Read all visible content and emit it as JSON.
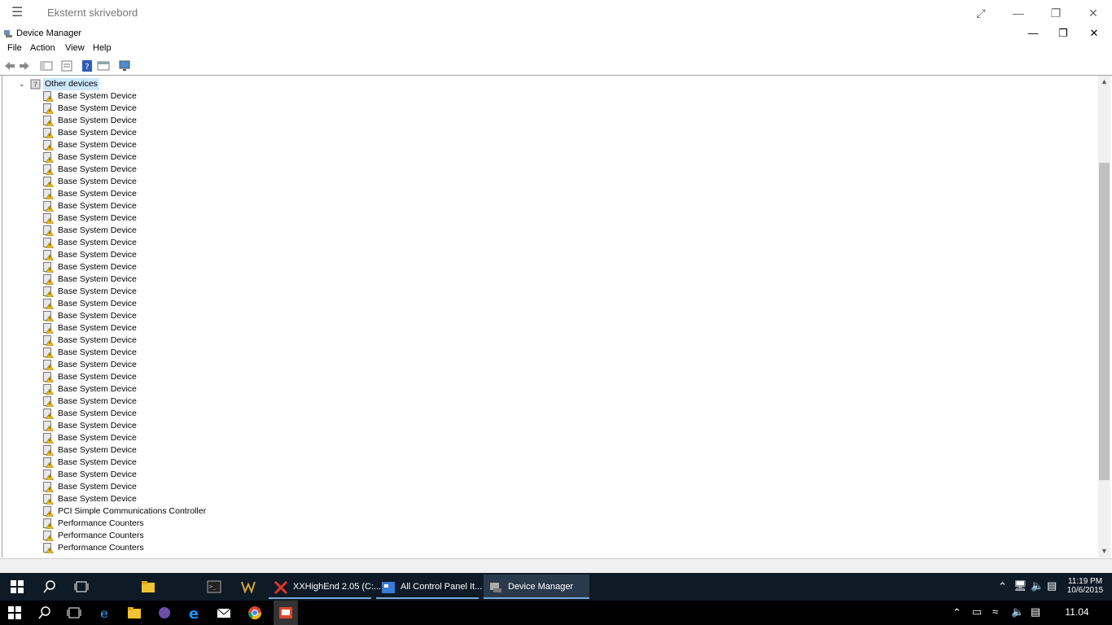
{
  "remote": {
    "title": "Eksternt skrivebord"
  },
  "window": {
    "title": "Device Manager"
  },
  "menu": [
    "File",
    "Action",
    "View",
    "Help"
  ],
  "tree": {
    "category": "Other devices",
    "items": [
      "Base System Device",
      "Base System Device",
      "Base System Device",
      "Base System Device",
      "Base System Device",
      "Base System Device",
      "Base System Device",
      "Base System Device",
      "Base System Device",
      "Base System Device",
      "Base System Device",
      "Base System Device",
      "Base System Device",
      "Base System Device",
      "Base System Device",
      "Base System Device",
      "Base System Device",
      "Base System Device",
      "Base System Device",
      "Base System Device",
      "Base System Device",
      "Base System Device",
      "Base System Device",
      "Base System Device",
      "Base System Device",
      "Base System Device",
      "Base System Device",
      "Base System Device",
      "Base System Device",
      "Base System Device",
      "Base System Device",
      "Base System Device",
      "Base System Device",
      "Base System Device",
      "PCI Simple Communications Controller",
      "Performance Counters",
      "Performance Counters",
      "Performance Counters"
    ]
  },
  "inner_taskbar": {
    "tasks": [
      {
        "label": "XXHighEnd 2.05 (C:..."
      },
      {
        "label": "All Control Panel It..."
      },
      {
        "label": "Device Manager"
      }
    ],
    "clock_time": "11:19 PM",
    "clock_date": "10/6/2015"
  },
  "outer_taskbar": {
    "clock_time": "11.04"
  },
  "colors": {
    "taskbar_inner": "#0e1a26",
    "taskbar_outer": "#000000",
    "selection": "#cce8ff",
    "task_underline": "#7aa7d4"
  }
}
